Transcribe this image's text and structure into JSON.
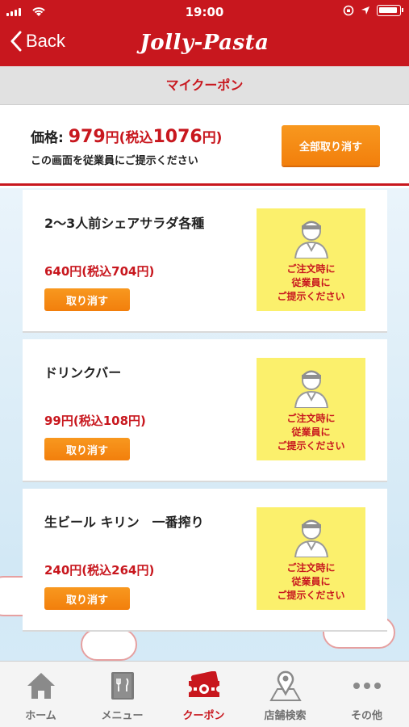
{
  "status_bar": {
    "time": "19:00"
  },
  "header": {
    "back_label": "Back",
    "logo_text": "Jolly-Pasta"
  },
  "page_title": "マイクーポン",
  "summary": {
    "price_label": "価格:",
    "price": "979",
    "price_unit": "円",
    "tax_open": "(税込",
    "tax_price": "1076",
    "tax_close": "円)",
    "hint": "この画面を従業員にご提示ください",
    "cancel_all_label": "全部取り消す"
  },
  "coupons": [
    {
      "name": "2〜3人前シェアサラダ各種",
      "price": "640円(税込704円)",
      "cancel_label": "取り消す",
      "badge": [
        "ご注文時に",
        "従業員に",
        "ご提示ください"
      ]
    },
    {
      "name": "ドリンクバー",
      "price": "99円(税込108円)",
      "cancel_label": "取り消す",
      "badge": [
        "ご注文時に",
        "従業員に",
        "ご提示ください"
      ]
    },
    {
      "name": "生ビール キリン　一番搾り",
      "price": "240円(税込264円)",
      "cancel_label": "取り消す",
      "badge": [
        "ご注文時に",
        "従業員に",
        "ご提示ください"
      ]
    }
  ],
  "tabs": [
    {
      "label": "ホーム",
      "icon": "home-icon",
      "active": false
    },
    {
      "label": "メニュー",
      "icon": "menu-book-icon",
      "active": false
    },
    {
      "label": "クーポン",
      "icon": "coupon-ticket-icon",
      "active": true
    },
    {
      "label": "店舗検索",
      "icon": "map-pin-icon",
      "active": false
    },
    {
      "label": "その他",
      "icon": "more-dots-icon",
      "active": false
    }
  ],
  "colors": {
    "brand_red": "#c8171e",
    "accent_orange": "#f4870f",
    "badge_yellow": "#fbf06c"
  }
}
